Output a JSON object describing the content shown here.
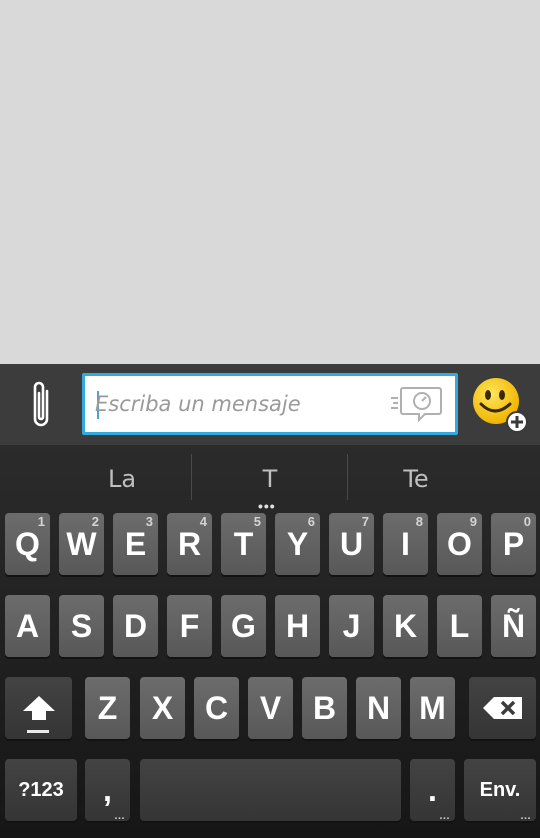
{
  "compose": {
    "placeholder": "Escriba un mensaje"
  },
  "suggestions": [
    "La",
    "T",
    "Te"
  ],
  "keyboard": {
    "row1": [
      {
        "label": "Q",
        "hint": "1"
      },
      {
        "label": "W",
        "hint": "2"
      },
      {
        "label": "E",
        "hint": "3"
      },
      {
        "label": "R",
        "hint": "4"
      },
      {
        "label": "T",
        "hint": "5"
      },
      {
        "label": "Y",
        "hint": "6"
      },
      {
        "label": "U",
        "hint": "7"
      },
      {
        "label": "I",
        "hint": "8"
      },
      {
        "label": "O",
        "hint": "9"
      },
      {
        "label": "P",
        "hint": "0"
      }
    ],
    "row2": [
      "A",
      "S",
      "D",
      "F",
      "G",
      "H",
      "J",
      "K",
      "L",
      "Ñ"
    ],
    "row3": [
      "Z",
      "X",
      "C",
      "V",
      "B",
      "N",
      "M"
    ],
    "symbols_label": "?123",
    "comma_label": ",",
    "period_label": ".",
    "enter_label": "Env."
  }
}
